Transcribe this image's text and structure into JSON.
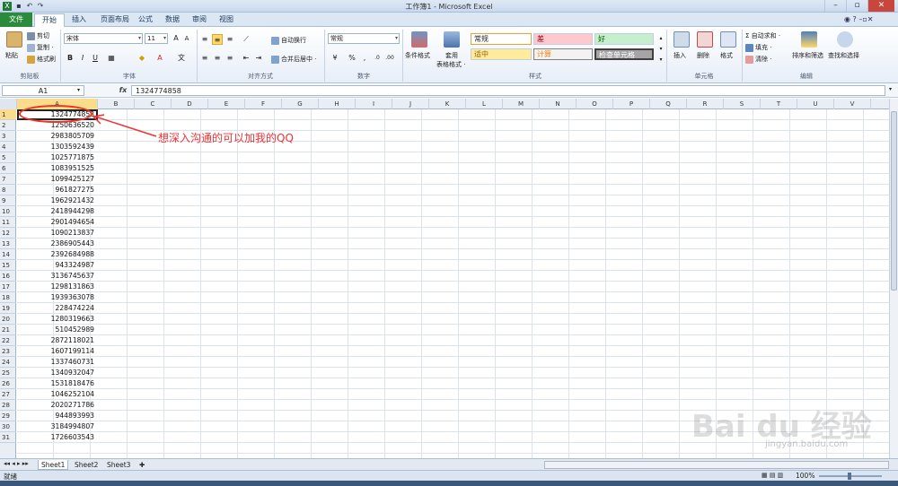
{
  "window": {
    "title": "工作簿1 - Microsoft Excel"
  },
  "quick_access": {
    "save_icon": "save-icon",
    "undo_icon": "undo-icon",
    "redo_icon": "redo-icon"
  },
  "tabs": [
    {
      "label": "文件"
    },
    {
      "label": "开始"
    },
    {
      "label": "插入"
    },
    {
      "label": "页面布局"
    },
    {
      "label": "公式"
    },
    {
      "label": "数据"
    },
    {
      "label": "审阅"
    },
    {
      "label": "视图"
    }
  ],
  "ribbon": {
    "clipboard": {
      "paste": "粘贴",
      "cut": "剪切",
      "copy": "复制 ·",
      "format_painter": "格式刷",
      "label": "剪贴板"
    },
    "font": {
      "name": "宋体",
      "size": "11",
      "label": "字体"
    },
    "alignment": {
      "wrap": "自动换行",
      "merge": "合并后居中 ·",
      "label": "对齐方式"
    },
    "number": {
      "format": "常规",
      "label": "数字"
    },
    "styles": {
      "conditional": "条件格式",
      "table": "套用",
      "table2": "表格格式 ·",
      "cells": [
        {
          "label": "常规"
        },
        {
          "label": "差"
        },
        {
          "label": "好"
        },
        {
          "label": "适中"
        },
        {
          "label": "计算"
        },
        {
          "label": "检查单元格"
        }
      ],
      "label": "样式"
    },
    "cells": {
      "insert": "插入",
      "delete": "删除",
      "format": "格式",
      "label": "单元格"
    },
    "editing": {
      "autosum": "自动求和 ·",
      "fill": "填充 ·",
      "clear": "清除 ·",
      "sort": "排序和筛选",
      "find": "查找和选择",
      "label": "编辑"
    }
  },
  "formula_bar": {
    "name_box": "A1",
    "fx": "fx",
    "content": "1324774858"
  },
  "columns": [
    "A",
    "B",
    "C",
    "D",
    "E",
    "F",
    "G",
    "H",
    "I",
    "J",
    "K",
    "L",
    "M",
    "N",
    "O",
    "P",
    "Q",
    "R",
    "S",
    "T",
    "U",
    "V"
  ],
  "rows": [
    {
      "n": "1",
      "a": "1324774858"
    },
    {
      "n": "2",
      "a": "1250636520"
    },
    {
      "n": "3",
      "a": "2983805709"
    },
    {
      "n": "4",
      "a": "1303592439"
    },
    {
      "n": "5",
      "a": "1025771875"
    },
    {
      "n": "6",
      "a": "1083951525"
    },
    {
      "n": "7",
      "a": "1099425127"
    },
    {
      "n": "8",
      "a": "961827275"
    },
    {
      "n": "9",
      "a": "1962921432"
    },
    {
      "n": "10",
      "a": "2418944298"
    },
    {
      "n": "11",
      "a": "2901494654"
    },
    {
      "n": "12",
      "a": "1090213837"
    },
    {
      "n": "13",
      "a": "2386905443"
    },
    {
      "n": "14",
      "a": "2392684988"
    },
    {
      "n": "15",
      "a": "943324987"
    },
    {
      "n": "16",
      "a": "3136745637"
    },
    {
      "n": "17",
      "a": "1298131863"
    },
    {
      "n": "18",
      "a": "1939363078"
    },
    {
      "n": "19",
      "a": "228474224"
    },
    {
      "n": "20",
      "a": "1280319663"
    },
    {
      "n": "21",
      "a": "510452989"
    },
    {
      "n": "22",
      "a": "2872118021"
    },
    {
      "n": "23",
      "a": "1607199114"
    },
    {
      "n": "24",
      "a": "1337460731"
    },
    {
      "n": "25",
      "a": "1340932047"
    },
    {
      "n": "26",
      "a": "1531818476"
    },
    {
      "n": "27",
      "a": "1046252104"
    },
    {
      "n": "28",
      "a": "2020271786"
    },
    {
      "n": "29",
      "a": "944893993"
    },
    {
      "n": "30",
      "a": "3184994807"
    },
    {
      "n": "31",
      "a": "1726603543"
    }
  ],
  "annotation": "想深入沟通的可以加我的QQ",
  "sheets": [
    {
      "label": "Sheet1"
    },
    {
      "label": "Sheet2"
    },
    {
      "label": "Sheet3"
    }
  ],
  "status": {
    "ready": "就绪",
    "zoom": "100%"
  },
  "watermark": {
    "text": "Bai du 经验",
    "url": "jingyan.baidu.com"
  },
  "colors": {
    "file_tab": "#2a8b3c",
    "annotation": "#e33333",
    "bad_bg": "#ffc7ce",
    "good_bg": "#c6efce",
    "neutral_bg": "#ffeb9c"
  }
}
